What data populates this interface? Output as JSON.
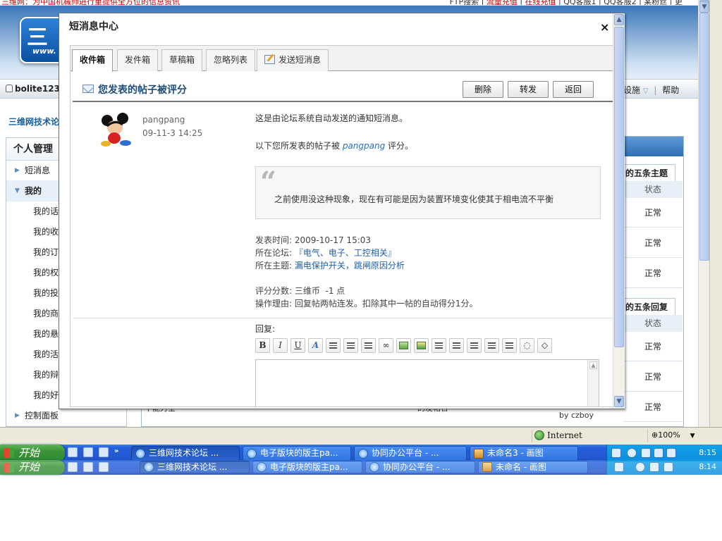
{
  "background": {
    "notice": "三维网：为中国机械师进行重提供全方位的信息资讯",
    "top_links": [
      "FTP搜索",
      "流量充值",
      "在线充值",
      "QQ客服1",
      "QQ客服2",
      "某粉丝",
      "更"
    ],
    "logo_text": "三",
    "logo_url": "www.",
    "username": "bolite123",
    "nav_right": [
      "设施",
      "帮助"
    ],
    "forum_title": "三维网技术论",
    "sidebar": {
      "title": "个人管理",
      "items": [
        "短消息",
        "我的"
      ],
      "subitems": [
        "我的话",
        "我的收",
        "我的订",
        "我的权",
        "我的投",
        "我的商",
        "我的悬",
        "我的活",
        "我的辩",
        "我的好"
      ],
      "footer": "控制面板"
    },
    "right_panel": {
      "title1": "的五条主题",
      "title2": "的五条回复",
      "col_header": "状态",
      "status": "正常"
    },
    "fragment_left": "干能力全",
    "fragment_mid": "的发帖合",
    "byline": "by czboy"
  },
  "dialog": {
    "title": "短消息中心",
    "close_label": "×",
    "tabs": [
      "收件箱",
      "发件箱",
      "草稿箱",
      "忽略列表",
      "发送短消息"
    ],
    "subject": "您发表的帖子被评分",
    "actions": [
      "删除",
      "转发",
      "返回"
    ],
    "sender": "pangpang",
    "date": "09-11-3 14:25",
    "intro": "这是由论坛系统自动发送的通知短消息。",
    "rate_prefix": "以下您所发表的帖子被 ",
    "rate_user": "pangpang",
    "rate_suffix": " 评分。",
    "quote": "之前使用没这种现象，现在有可能是因为装置环境变化使其于相电流不平衡",
    "post_time_label": "发表时间:",
    "post_time": "2009-10-17 15:03",
    "forum_label": "所在论坛:",
    "forum": "『电气、电子、工控相关』",
    "thread_label": "所在主题:",
    "thread": "漏电保护开关，跳闸原因分析",
    "score_label": "评分分数:",
    "score": "三维币  -1 点",
    "reason_label": "操作理由:",
    "reason": "回复帖两帖连发。扣除其中一帖的自动得分1分。",
    "reply_label": "回复:",
    "toolbar": [
      "B",
      "I",
      "U",
      "A"
    ]
  },
  "status_bar": {
    "zone": "Internet",
    "zoom": "100%"
  },
  "taskbar": {
    "start": "开始",
    "clock": "8:15",
    "tasks": [
      "三维网技术论坛 ...",
      "电子版块的版主pa...",
      "协同办公平台 - ...",
      "未命名3 - 画图"
    ]
  },
  "taskbar2": {
    "start": "开始",
    "clock": "8:14",
    "tasks": [
      "三维网技术论坛 ...",
      "电子版块的版主pa...",
      "协同办公平台 - ...",
      "未命名 - 画图"
    ]
  },
  "colors": {
    "accent": "#1f5fa8",
    "taskbar": "#245edb",
    "start": "#3b9337"
  }
}
